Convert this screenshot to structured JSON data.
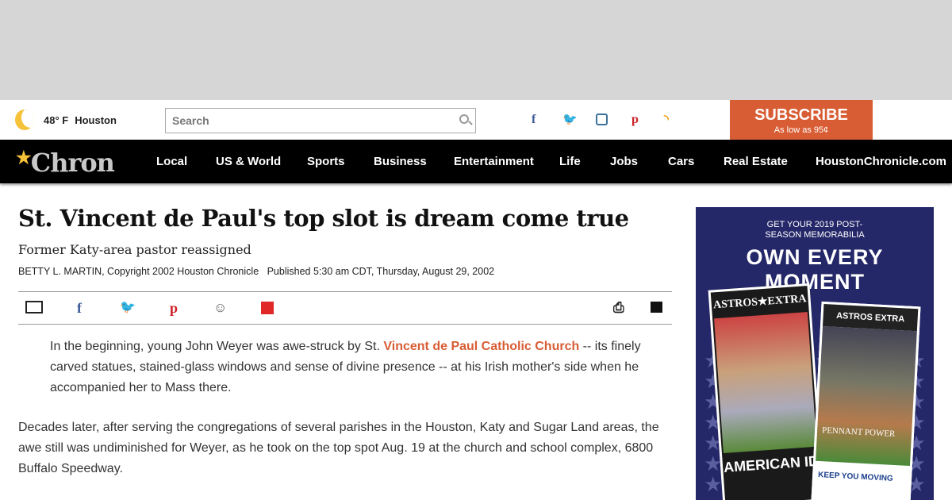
{
  "header": {
    "temp": "48° F",
    "city": "Houston",
    "search_placeholder": "Search",
    "subscribe": "SUBSCRIBE",
    "subscribe_sub": "As low as 95¢",
    "social": [
      {
        "icon": "facebook-icon",
        "glyph": "f",
        "color": "#3b5998"
      },
      {
        "icon": "twitter-icon",
        "glyph": "🐦",
        "color": "#1da1f2"
      },
      {
        "icon": "instagram-icon",
        "glyph": "◙",
        "color": "#3f729b"
      },
      {
        "icon": "pinterest-icon",
        "glyph": "P",
        "color": "#cb2027"
      },
      {
        "icon": "rss-icon",
        "glyph": "◗",
        "color": "#f39c12"
      }
    ]
  },
  "nav": {
    "logo": "Chron",
    "items": [
      "Local",
      "US & World",
      "Sports",
      "Business",
      "Entertainment",
      "Life",
      "Jobs",
      "Cars",
      "Real Estate",
      "HoustonChronicle.com"
    ]
  },
  "article": {
    "title": "St. Vincent de Paul's top slot is dream come true",
    "subtitle": "Former Katy-area pastor reassigned",
    "byline": "BETTY L. MARTIN, Copyright 2002 Houston Chronicle",
    "published": "Published 5:30 am CDT, Thursday, August 29, 2002",
    "p1_a": "In the beginning, young John Weyer was awe-struck by St. ",
    "p1_link": "Vincent de Paul Catholic Church",
    "p1_b": " -- its finely carved statues, stained-glass windows and sense of divine presence -- at his Irish mother's side when he accompanied her to Mass there.",
    "p2": "Decades later, after serving the congregations of several parishes in the Houston, Katy and Sugar Land areas, the awe still was undiminished for Weyer, as he took on the top spot Aug. 19 at the church and school complex, 6800 Buffalo Speedway."
  },
  "ad": {
    "line1": "GET YOUR 2019 POST-SEASON MEMORABILIA",
    "line2": "OWN EVERY MOMENT",
    "paper1_title": "ASTROS★EXTRA",
    "paper1_head": "AMERICAN ID",
    "paper2_title": "ASTROS EXTRA",
    "paper2_head": "PENNANT POWER",
    "paper2_ad": "KEEP YOU MOVING"
  }
}
